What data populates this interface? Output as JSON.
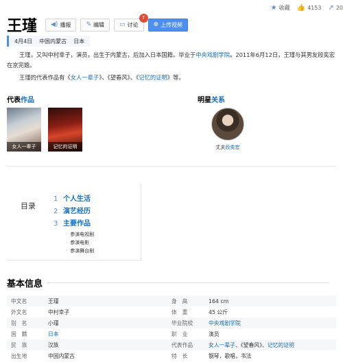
{
  "topbar": {
    "collect_label": "收藏",
    "like_count": "4153",
    "share_count": "20"
  },
  "title": "王瑾",
  "toolbar": {
    "play": "播报",
    "edit": "编辑",
    "discuss": "讨论",
    "discuss_badge": "7",
    "upload": "上传视频"
  },
  "basic_tags": [
    "4月4日",
    "中国内蒙古",
    "日本"
  ],
  "intro": {
    "p1_a": "王瑾，又叫中村幸子，演员，出生于内蒙古，后加入日本国籍。毕业于",
    "p1_link": "中央戏剧学院",
    "p1_b": "。2011年6月12日，王瑾与其男友段奕宏在京完婚。",
    "p2_a": "王瑾的代表作品有《",
    "p2_link1": "女人一辈子",
    "p2_b": "》、《望春风》、《",
    "p2_link2": "记忆的证明",
    "p2_c": "》等。"
  },
  "works": {
    "head_a": "代表",
    "head_b": "作品",
    "items": [
      {
        "caption": "女人一辈子"
      },
      {
        "caption": "记忆的证明"
      }
    ]
  },
  "relations": {
    "head_a": "明星",
    "head_b": "关系",
    "items": [
      {
        "role": "丈夫",
        "name": "段奕宏"
      }
    ]
  },
  "toc": {
    "label": "目录",
    "items": [
      {
        "num": "1",
        "label": "个人生活"
      },
      {
        "num": "2",
        "label": "演艺经历"
      },
      {
        "num": "3",
        "label": "主要作品"
      }
    ],
    "subs": [
      "参演电视剧",
      "参演电影",
      "参演舞台剧"
    ]
  },
  "info": {
    "title": "基本信息",
    "rows": [
      {
        "k1": "中文名",
        "v1": "王瑾",
        "k2": "身　高",
        "v2": "164 cm"
      },
      {
        "k1": "外文名",
        "v1": "中村幸子",
        "k2": "体　重",
        "v2": "45 公斤"
      },
      {
        "k1": "别　名",
        "v1": "小瑾",
        "k2": "毕业院校",
        "v2": "中央戏剧学院"
      },
      {
        "k1": "国　籍",
        "v1": "日本",
        "k2": "职　业",
        "v2": "演员"
      },
      {
        "k1": "民　族",
        "v1": "汉族",
        "k2": "代表作品",
        "v2a": "女人一辈子",
        "v2b": "、《望春风》、",
        "v2c": "记忆的证明"
      },
      {
        "k1": "出生地",
        "v1": "中国内蒙古",
        "k2": "特　长",
        "v2": "钢琴，歌唱，书法"
      }
    ]
  }
}
